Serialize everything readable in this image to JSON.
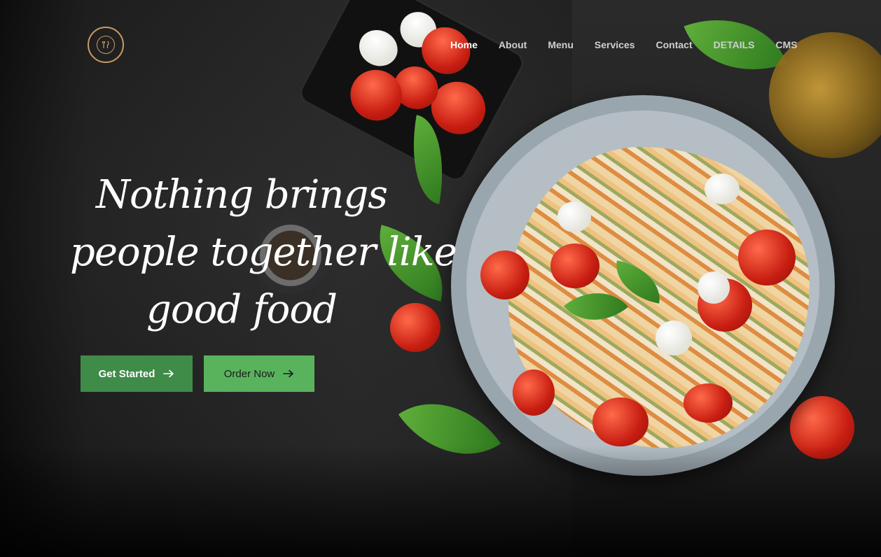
{
  "nav": {
    "items": [
      {
        "label": "Home",
        "active": true
      },
      {
        "label": "About",
        "active": false
      },
      {
        "label": "Menu",
        "active": false
      },
      {
        "label": "Services",
        "active": false
      },
      {
        "label": "Contact",
        "active": false
      },
      {
        "label": "DETAILS",
        "active": false
      },
      {
        "label": "CMS",
        "active": false
      }
    ]
  },
  "logo": {
    "icon": "fork-knife-icon"
  },
  "hero": {
    "headline_lines": [
      "Nothing brings",
      "people together like",
      "good food"
    ],
    "buttons": {
      "primary_label": "Get Started",
      "secondary_label": "Order Now",
      "arrow_icon": "arrow-right-icon"
    }
  },
  "colors": {
    "primary_button": "#3f8c48",
    "secondary_button": "#59b35d",
    "logo_ring": "#c89b63",
    "nav_active": "#ffffff",
    "nav_inactive": "#cfcfcf"
  }
}
